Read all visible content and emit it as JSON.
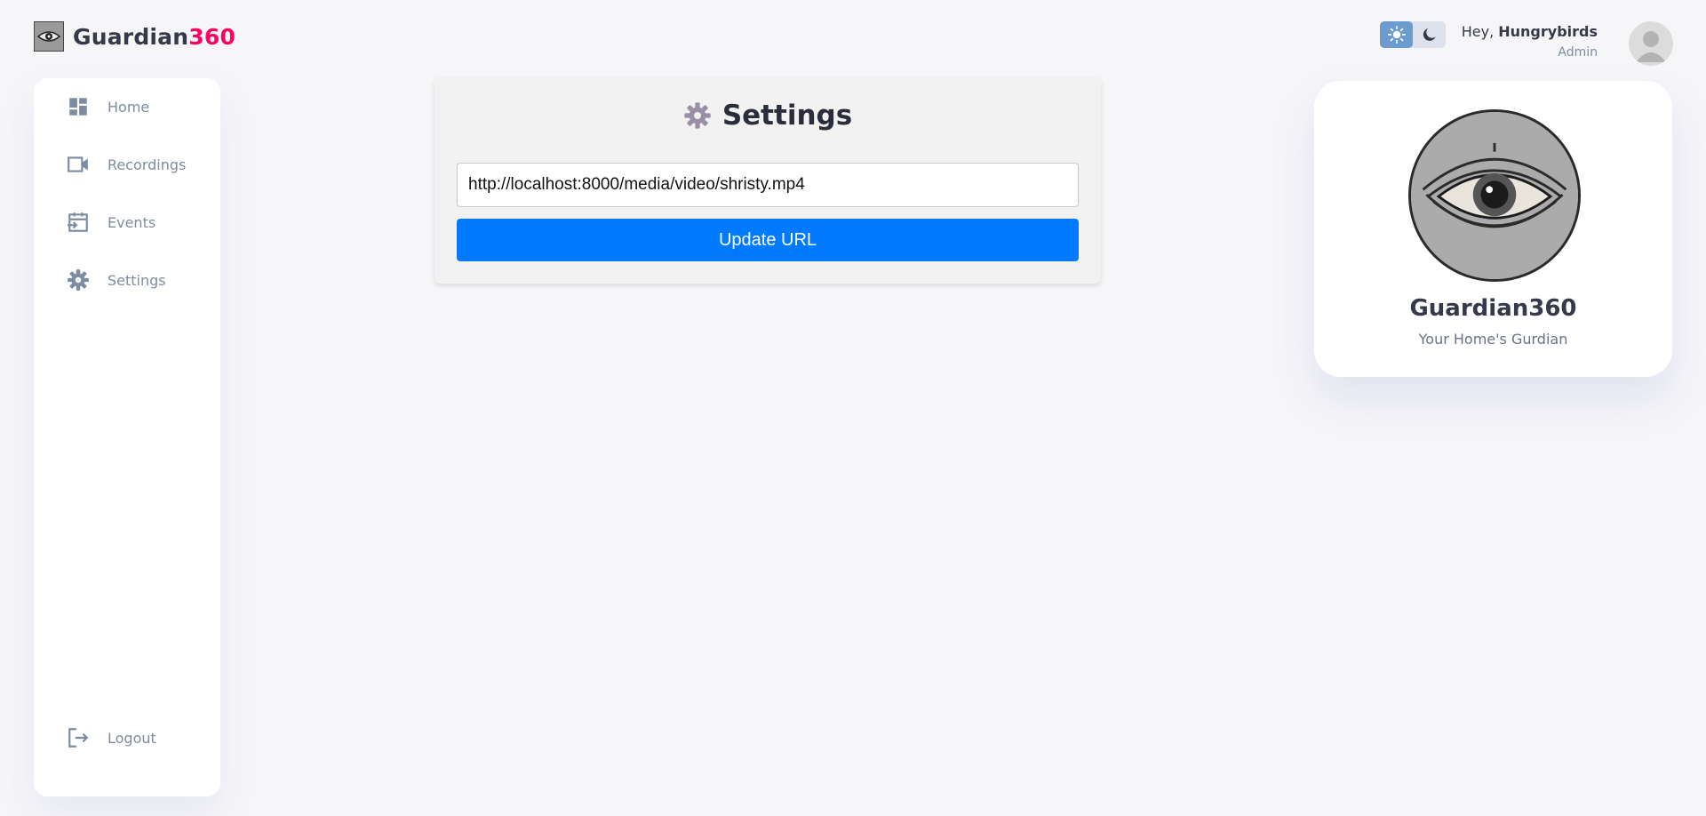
{
  "logo": {
    "name_main": "Guardian",
    "name_accent": "360",
    "icon": "eye-logo-icon"
  },
  "sidebar": {
    "items": [
      {
        "label": "Home",
        "icon": "dashboard-icon"
      },
      {
        "label": "Recordings",
        "icon": "video-camera-icon"
      },
      {
        "label": "Events",
        "icon": "calendar-icon"
      },
      {
        "label": "Settings",
        "icon": "gear-icon"
      }
    ],
    "logout": {
      "label": "Logout",
      "icon": "logout-icon"
    }
  },
  "settings": {
    "title": "Settings",
    "url_value": "http://localhost:8000/media/video/shristy.mp4",
    "update_label": "Update URL"
  },
  "header": {
    "greeting": "Hey, ",
    "username": "Hungrybirds",
    "role": "Admin",
    "theme": {
      "active": "light"
    }
  },
  "profile": {
    "name": "Guardian360",
    "tagline": "Your Home's Gurdian"
  },
  "colors": {
    "accent": "#ff0060",
    "primary_button": "#007bff",
    "toggle_active": "#6c9bcf",
    "background": "#f6f6f9"
  }
}
